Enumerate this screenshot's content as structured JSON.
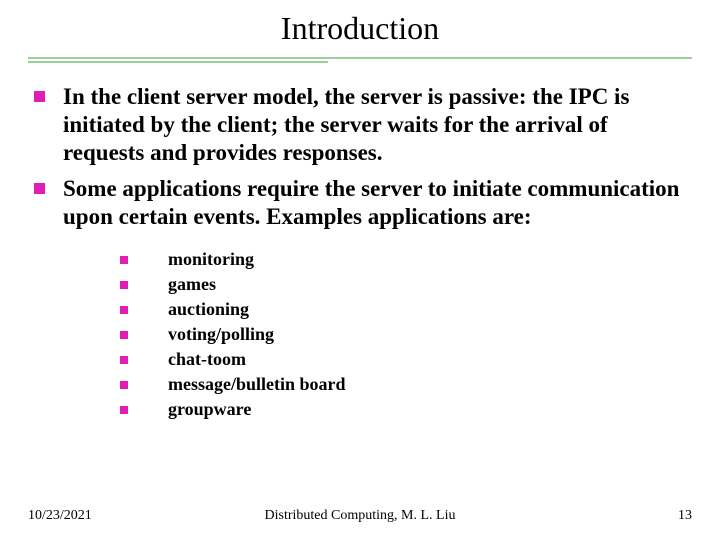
{
  "title": "Introduction",
  "bullets": [
    "In the client server model, the server is passive: the IPC is initiated by the client; the server waits for the arrival of requests and provides responses.",
    "Some applications require the server to initiate communication upon certain events.  Examples applications are:"
  ],
  "sub_bullets": [
    "monitoring",
    "games",
    "auctioning",
    "voting/polling",
    "chat-toom",
    " message/bulletin board",
    " groupware"
  ],
  "footer": {
    "date": "10/23/2021",
    "center": "Distributed Computing, M. L. Liu",
    "page": "13"
  }
}
